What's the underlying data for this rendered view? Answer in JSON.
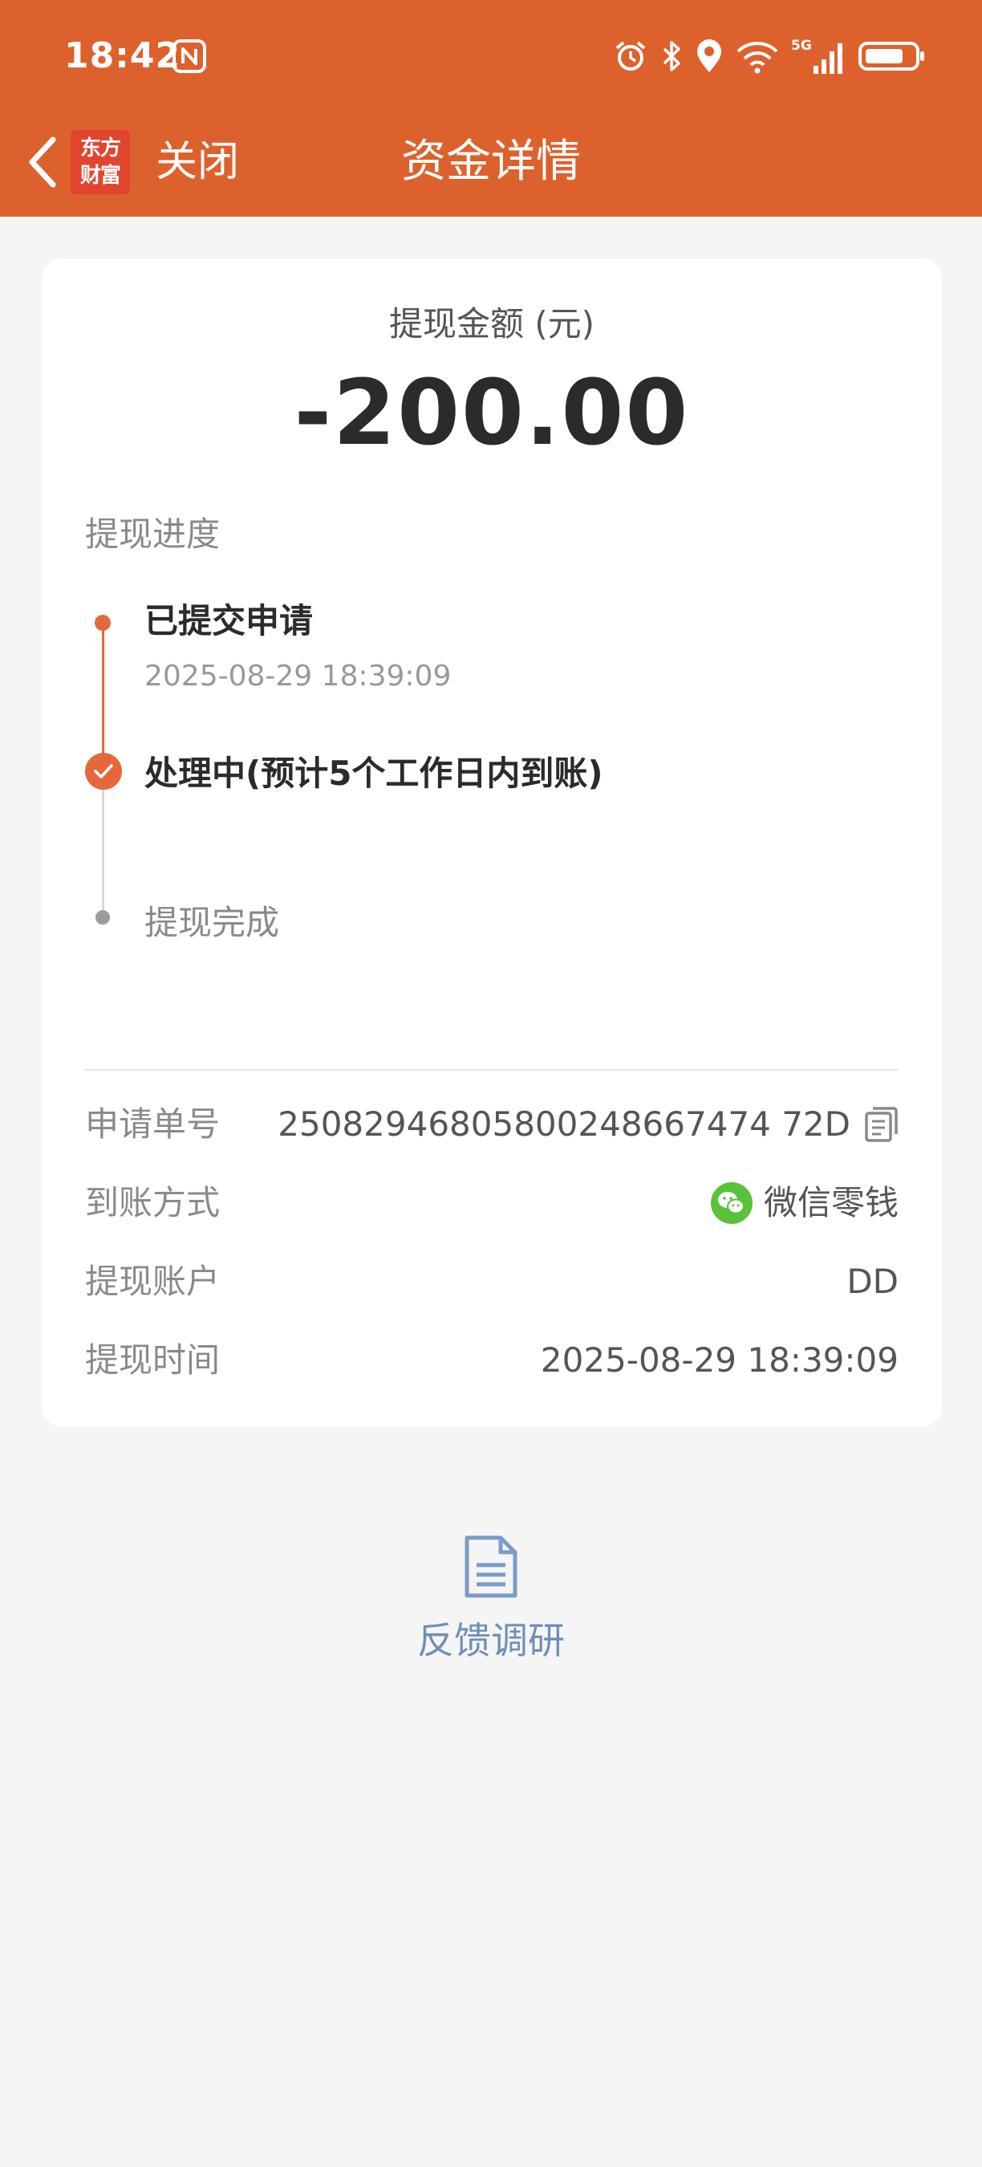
{
  "status_bar": {
    "time": "18:42",
    "network_label": "5G"
  },
  "nav": {
    "logo_line1": "东方",
    "logo_line2": "财富",
    "close_label": "关闭",
    "title": "资金详情"
  },
  "amount": {
    "label": "提现金额 (元)",
    "value": "-200.00"
  },
  "progress": {
    "label": "提现进度",
    "steps": [
      {
        "title": "已提交申请",
        "time": "2025-08-29 18:39:09",
        "state": "done"
      },
      {
        "title": "处理中(预计5个工作日内到账)",
        "state": "current"
      },
      {
        "title": "提现完成",
        "state": "pending"
      }
    ]
  },
  "details": [
    {
      "label": "申请单号",
      "value": "25082946805800248667474 72D"
    },
    {
      "label": "到账方式",
      "value": "微信零钱"
    },
    {
      "label": "提现账户",
      "value": "DD"
    },
    {
      "label": "提现时间",
      "value": "2025-08-29 18:39:09"
    }
  ],
  "feedback": {
    "label": "反馈调研"
  },
  "colors": {
    "header": "#dd612d",
    "accent": "#e5683a",
    "link": "#6f8fb6",
    "wechat": "#5ac13a"
  }
}
